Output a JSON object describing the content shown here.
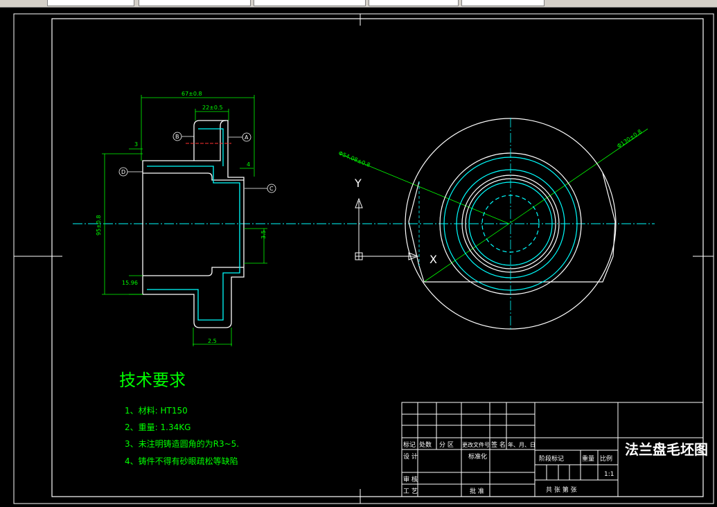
{
  "drawing": {
    "tech_req_title": "技术要求",
    "tech_req": [
      "1、材料: HT150",
      "2、重量: 1.34KG",
      "3、未注明铸造圆角的为R3~5.",
      "4、铸件不得有砂眼疏松等缺陷"
    ],
    "dims": {
      "d67": "67±0.8",
      "d22": "22±0.5",
      "d3": "3",
      "d4": "4",
      "d95": "95±0.8",
      "d15": "15.96",
      "d25": "2.5",
      "d35": "3.5",
      "dia54": "Φ54.08±0.8",
      "dia130": "Φ130±0.8"
    },
    "datums": {
      "B": "B",
      "A": "A",
      "D": "D",
      "C": "C"
    },
    "ucs": {
      "x": "X",
      "y": "Y"
    }
  },
  "title_block": {
    "drawing_name": "法兰盘毛坯图",
    "labels": {
      "mark": "标记",
      "count": "处数",
      "zone": "分 区",
      "doc": "更改文件号",
      "sign": "签 名",
      "date": "年、月、日",
      "design": "设 计",
      "std": "标准化",
      "review": "审 核",
      "process": "工 艺",
      "approve": "批 准",
      "stage": "阶段标记",
      "weight": "重量",
      "scale": "比例",
      "scale_val": "1:1",
      "sheets": "共   张 第   张"
    }
  }
}
